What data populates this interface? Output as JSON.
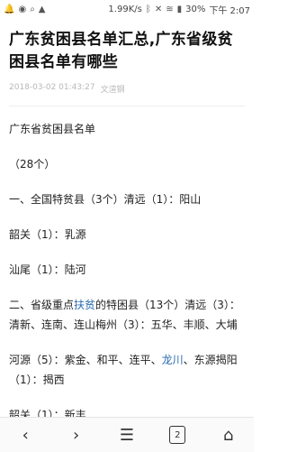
{
  "status_bar": {
    "speed": "1.99K/s",
    "battery": "30%",
    "time": "下午 2:07",
    "left_icons": [
      "bell-icon",
      "qq-icon",
      "search-icon",
      "triangle-icon"
    ],
    "right_icons": [
      "bluetooth-icon",
      "mute-icon",
      "wifi-icon",
      "signal-icon",
      "battery-icon"
    ]
  },
  "article": {
    "title": "广东贫困县名单汇总,广东省级贫困县名单有哪些",
    "date": "2018-03-02 01:43:27",
    "source": "文渲钢",
    "paragraphs": [
      "广东省贫困县名单",
      "（28个）",
      "一、全国特贫县（3个）清远（1）：阳山",
      "韶关（1）：乳源",
      "汕尾（1）：陆河"
    ],
    "p6_pre": "二、省级重点",
    "p6_link": "扶贫",
    "p6_post": "的特困县（13个）清远（3）：清新、连南、连山梅州（3）：五华、丰顺、大埔",
    "p7_pre": "河源（5）：紫金、和平、连平、",
    "p7_link": "龙川",
    "p7_post": "、东源揭阳（1）：揭西",
    "p8": "韶关（1）：新丰"
  },
  "navbar": {
    "tab_count": "2"
  }
}
